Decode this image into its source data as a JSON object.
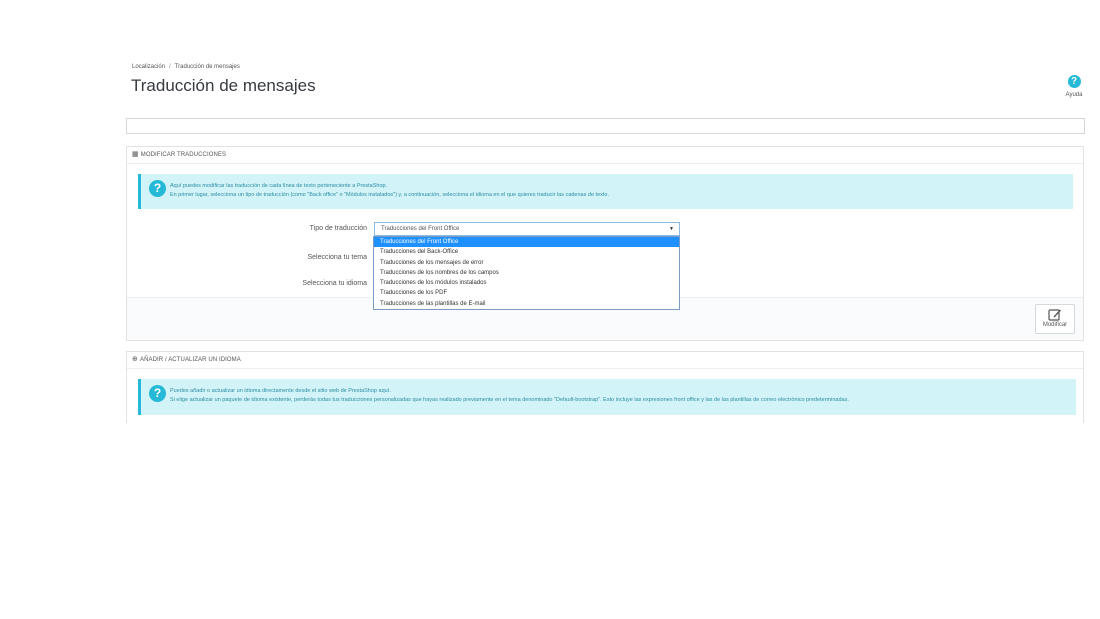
{
  "breadcrumb": {
    "parent": "Localización",
    "separator": "/",
    "current": "Traducción de mensajes"
  },
  "page_title": "Traducción de mensajes",
  "help": {
    "icon": "question-circle-icon",
    "label": "Ayuda"
  },
  "modify_panel": {
    "heading": "Modificar traducciones",
    "heading_icon": "book-icon",
    "alert_lines": [
      "Aquí puedes modificar las traducción de cada línea de texto perteneciente a PrestaShop.",
      "En primer lugar, selecciona un tipo de traducción (como \"Back office\" o \"Módulos instalados\") y, a continuación, selecciona el idioma en el que quieres traducir las cadenas de texto."
    ],
    "fields": {
      "type_label": "Tipo de traducción",
      "type_value": "Traducciones del Front Office",
      "theme_label": "Selecciona tu tema",
      "language_label": "Selecciona tu idioma"
    },
    "dropdown_options": [
      "Traducciones del Front Office",
      "Traducciones del Back-Office",
      "Traducciones de los mensajes de error",
      "Traducciones de los nombres de los campos",
      "Traducciones de los módulos instalados",
      "Traducciones de los PDF",
      "Traducciones de las plantillas de E-mail"
    ],
    "selected_option_index": 0,
    "modify_button": "Modificar"
  },
  "add_panel": {
    "heading": "Añadir / actualizar un idioma",
    "heading_icon": "plus-circle-icon",
    "alert_lines": [
      "Puedes añadir o actualizar un idioma directamente desde el sitio web de PrestaShop aquí.",
      "Si elige actualizar un paquete de idioma existente, perderás todas tus traducciones personalizadas que hayas realizado previamente en el tema denominado \"Default-bootstrap\". Esto incluye las expresiones front office y las de las plantillas de correo electrónico predeterminadas."
    ]
  },
  "colors": {
    "accent": "#25b9d7",
    "alert_bg": "#d2f4f9",
    "selected_option": "#1e90ff"
  }
}
